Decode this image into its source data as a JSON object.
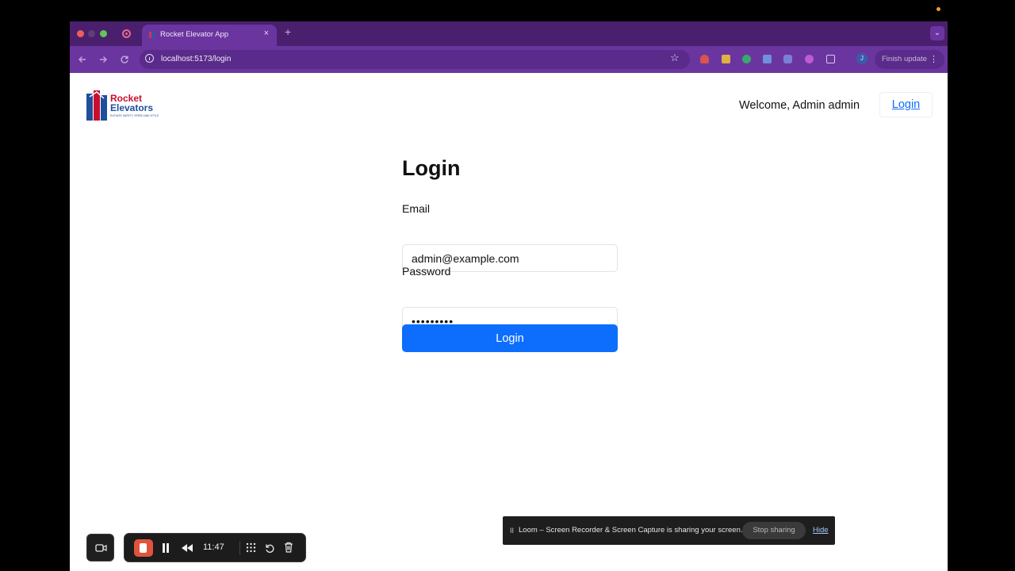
{
  "browser": {
    "tab_title": "Rocket Elevator App",
    "tab_close": "×",
    "new_tab": "+",
    "tab_menu": "⌄",
    "url": "localhost:5173/login",
    "finish_update": "Finish update",
    "profile_initial": "J",
    "accent_color": "#6b35a0"
  },
  "header": {
    "logo_line1": "Rocket",
    "logo_line2": "Elevators",
    "logo_tagline": "ELEVATE SAFETY, SPEED AND STYLE",
    "welcome": "Welcome, Admin admin",
    "login_link": "Login"
  },
  "form": {
    "title": "Login",
    "email_label": "Email",
    "email_value": "admin@example.com",
    "password_label": "Password",
    "password_value": "•••••••••",
    "submit_label": "Login",
    "button_color": "#0d6efd"
  },
  "share_bar": {
    "pause": "II",
    "message": "Loom – Screen Recorder & Screen Capture is sharing your screen.",
    "stop_label": "Stop sharing",
    "hide_label": "Hide"
  },
  "recorder": {
    "timer": "11:47"
  }
}
